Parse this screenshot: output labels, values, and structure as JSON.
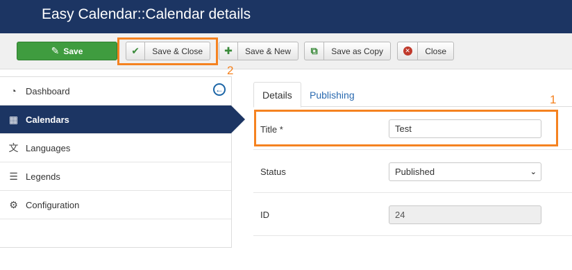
{
  "header": {
    "title": "Easy Calendar::Calendar details"
  },
  "toolbar": {
    "save_label": "Save",
    "save_close_label": "Save & Close",
    "save_new_label": "Save & New",
    "save_as_copy_label": "Save as Copy",
    "close_label": "Close"
  },
  "annotations": {
    "marker_1": "1",
    "marker_2": "2",
    "color": "#f58220"
  },
  "sidebar": {
    "items": [
      {
        "label": "Dashboard",
        "icon": "dashboard-icon"
      },
      {
        "label": "Calendars",
        "icon": "calendar-icon",
        "active": true
      },
      {
        "label": "Languages",
        "icon": "languages-icon"
      },
      {
        "label": "Legends",
        "icon": "list-icon"
      },
      {
        "label": "Configuration",
        "icon": "gear-icon"
      }
    ]
  },
  "tabs": [
    {
      "label": "Details",
      "active": true
    },
    {
      "label": "Publishing",
      "active": false
    }
  ],
  "form": {
    "title": {
      "label": "Title *",
      "value": "Test"
    },
    "status": {
      "label": "Status",
      "value": "Published"
    },
    "id": {
      "label": "ID",
      "value": "24"
    }
  },
  "colors": {
    "header_bg": "#1c3563",
    "save_green": "#3f9c3f",
    "link_blue": "#2a6ab0"
  }
}
